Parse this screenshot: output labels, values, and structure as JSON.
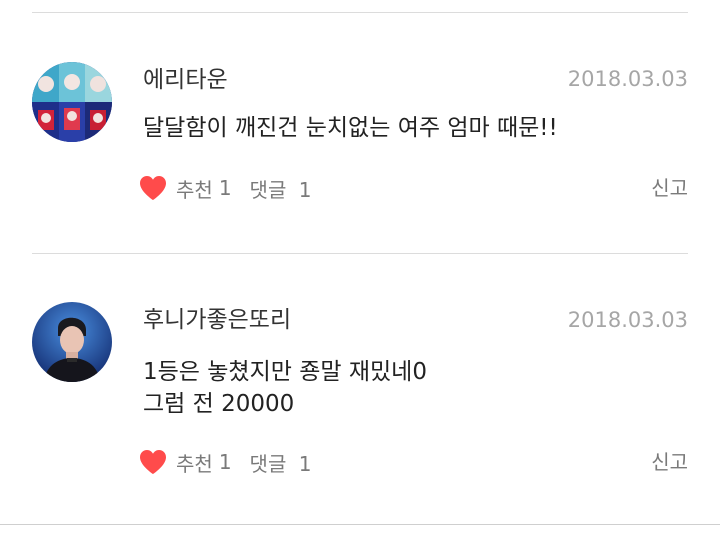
{
  "comments": [
    {
      "username": "에리타운",
      "date": "2018.03.03",
      "lines": [
        "달달함이 깨진건 눈치없는 여주 엄마 때문!!"
      ],
      "like_label": "추천",
      "like_count": "1",
      "reply_label": "댓글",
      "reply_count": "1",
      "report_label": "신고",
      "like_icon": "heart-icon",
      "like_color": "#ff4b4b"
    },
    {
      "username": "후니가좋은또리",
      "date": "2018.03.03",
      "lines": [
        "1등은 놓쳤지만 죵말 재밌네0",
        "그럼 전 20000"
      ],
      "like_label": "추천",
      "like_count": "1",
      "reply_label": "댓글",
      "reply_count": "1",
      "report_label": "신고",
      "like_icon": "heart-icon",
      "like_color": "#ff4b4b"
    }
  ]
}
